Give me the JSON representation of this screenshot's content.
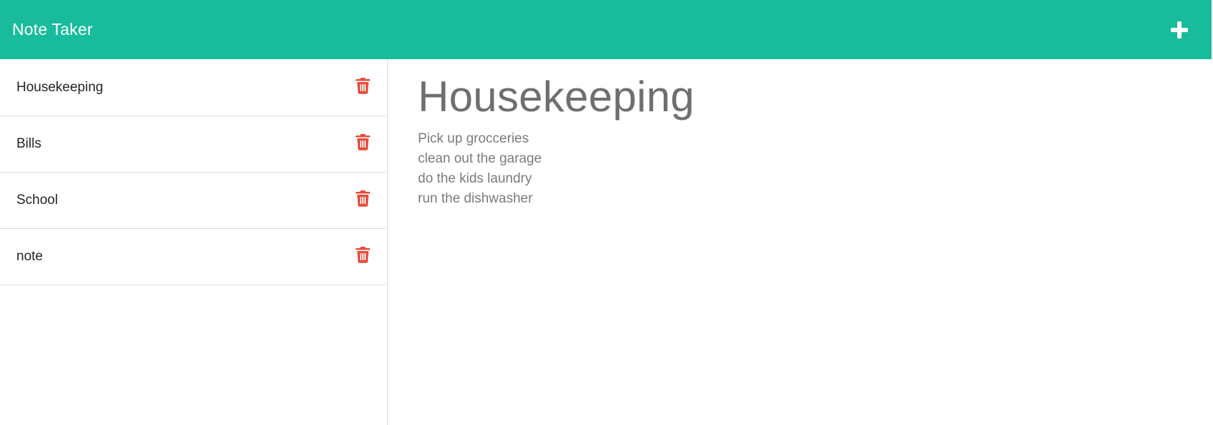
{
  "navbar": {
    "brand": "Note Taker",
    "add_icon": "plus-icon"
  },
  "sidebar": {
    "notes": [
      {
        "title": "Housekeeping",
        "delete_icon": "trash-icon"
      },
      {
        "title": "Bills",
        "delete_icon": "trash-icon"
      },
      {
        "title": "School",
        "delete_icon": "trash-icon"
      },
      {
        "title": "note",
        "delete_icon": "trash-icon"
      }
    ]
  },
  "main": {
    "title": "Housekeeping",
    "body": "Pick up grocceries\nclean out the garage\ndo the kids laundry\nrun the dishwasher"
  },
  "colors": {
    "navbar_bg": "#18bc9c",
    "delete_icon": "#e74c3c",
    "text_muted": "#6f6f6f"
  }
}
